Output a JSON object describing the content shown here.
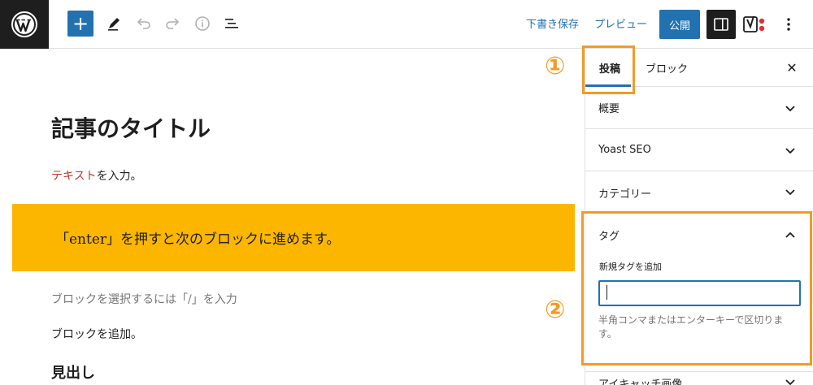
{
  "toolbar": {
    "add_symbol": "+",
    "draft_save": "下書き保存",
    "preview": "プレビュー",
    "publish": "公開"
  },
  "editor": {
    "title": "記事のタイトル",
    "para1_red": "テキスト",
    "para1_rest": "を入力。",
    "highlight": "「enter」を押すと次のブロックに進めます。",
    "placeholder": "ブロックを選択するには「/」を入力",
    "para2": "ブロックを追加。",
    "heading": "見出し"
  },
  "badges": {
    "one": "①",
    "two": "②"
  },
  "sidebar": {
    "tabs": [
      {
        "label": "投稿"
      },
      {
        "label": "ブロック"
      }
    ],
    "close_symbol": "✕",
    "panels": [
      {
        "title": "概要"
      },
      {
        "title": "Yoast SEO"
      },
      {
        "title": "カテゴリー"
      },
      {
        "title": "タグ"
      },
      {
        "title": "アイキャッチ画像"
      }
    ],
    "tag_field_label": "新規タグを追加",
    "tag_input_value": "",
    "tag_help": "半角コンマまたはエンターキーで区切ります。"
  },
  "colors": {
    "accent": "#2271b1",
    "highlight": "#fdb600",
    "annotation": "#f29b26",
    "red_text": "#c0392b"
  }
}
